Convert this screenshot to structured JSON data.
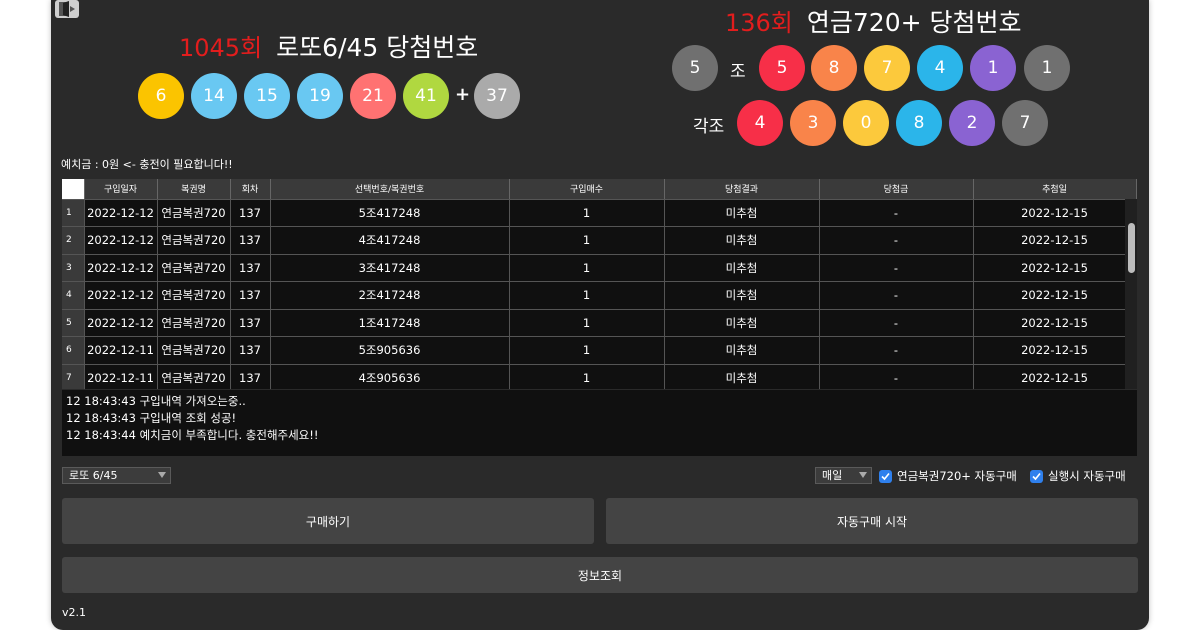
{
  "lotto": {
    "round": "1045회",
    "title": "로또6/45 당첨번호",
    "balls": [
      "6",
      "14",
      "15",
      "19",
      "21",
      "41"
    ],
    "plus": "+",
    "bonus": "37",
    "colors": {
      "yellow": "#fbc400",
      "blue": "#69c8f2",
      "red": "#ff7272",
      "gray": "#aaaaaa",
      "green": "#b0d840"
    }
  },
  "pension": {
    "round": "136회",
    "title": "연금720+ 당첨번호",
    "group": "5",
    "group_label": "조",
    "first_digits": [
      "5",
      "8",
      "7",
      "4",
      "1",
      "1"
    ],
    "each_label": "각조",
    "bonus_digits": [
      "4",
      "3",
      "0",
      "8",
      "2",
      "7"
    ]
  },
  "deposit_text": "예치금 : 0원 <- 충전이 필요합니다!!",
  "table": {
    "headers": [
      "구입일자",
      "복권명",
      "회차",
      "선택번호/복권번호",
      "구입매수",
      "당첨결과",
      "당첨금",
      "추첨일"
    ],
    "rows": [
      {
        "n": "1",
        "date": "2022-12-12",
        "name": "연금복권720",
        "round": "137",
        "number": "5조417248",
        "qty": "1",
        "result": "미추첨",
        "prize": "-",
        "draw": "2022-12-15"
      },
      {
        "n": "2",
        "date": "2022-12-12",
        "name": "연금복권720",
        "round": "137",
        "number": "4조417248",
        "qty": "1",
        "result": "미추첨",
        "prize": "-",
        "draw": "2022-12-15"
      },
      {
        "n": "3",
        "date": "2022-12-12",
        "name": "연금복권720",
        "round": "137",
        "number": "3조417248",
        "qty": "1",
        "result": "미추첨",
        "prize": "-",
        "draw": "2022-12-15"
      },
      {
        "n": "4",
        "date": "2022-12-12",
        "name": "연금복권720",
        "round": "137",
        "number": "2조417248",
        "qty": "1",
        "result": "미추첨",
        "prize": "-",
        "draw": "2022-12-15"
      },
      {
        "n": "5",
        "date": "2022-12-12",
        "name": "연금복권720",
        "round": "137",
        "number": "1조417248",
        "qty": "1",
        "result": "미추첨",
        "prize": "-",
        "draw": "2022-12-15"
      },
      {
        "n": "6",
        "date": "2022-12-11",
        "name": "연금복권720",
        "round": "137",
        "number": "5조905636",
        "qty": "1",
        "result": "미추첨",
        "prize": "-",
        "draw": "2022-12-15"
      },
      {
        "n": "7",
        "date": "2022-12-11",
        "name": "연금복권720",
        "round": "137",
        "number": "4조905636",
        "qty": "1",
        "result": "미추첨",
        "prize": "-",
        "draw": "2022-12-15"
      }
    ]
  },
  "log": [
    "12 18:43:43 구입내역 가져오는중..",
    "12 18:43:43 구입내역 조회 성공!",
    "12 18:43:44 예치금이 부족합니다. 충전해주세요!!"
  ],
  "controls": {
    "game_select": "로또 6/45",
    "period_select": "매일",
    "auto_pension_label": "연금복권720+ 자동구매",
    "auto_run_label": "실행시 자동구매",
    "buy_button": "구매하기",
    "auto_start_button": "자동구매 시작",
    "info_button": "정보조회"
  },
  "version": "v2.1",
  "icons": {
    "exit": "exit-icon",
    "check": "check-icon",
    "dropdown": "chevron-down-icon"
  }
}
